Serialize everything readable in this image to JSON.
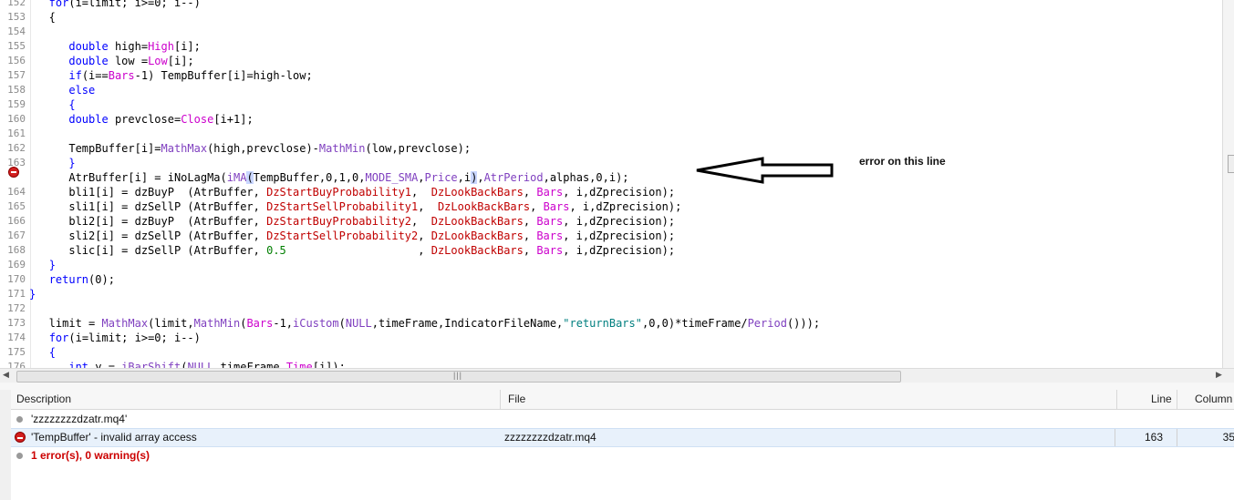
{
  "editor": {
    "line_numbers": [
      "152",
      "153",
      "154",
      "155",
      "156",
      "157",
      "158",
      "159",
      "160",
      "161",
      "162",
      "163",
      "164",
      "165",
      "166",
      "167",
      "168",
      "169",
      "170",
      "171",
      "172",
      "173",
      "174",
      "175",
      "176"
    ],
    "code_lines": [
      "   for(i=limit; i>=0; i--)",
      "   {",
      "",
      "      double high=High[i];",
      "      double low =Low[i];",
      "      if(i==Bars-1) TempBuffer[i]=high-low;",
      "      else",
      "      {",
      "      double prevclose=Close[i+1];",
      "",
      "      TempBuffer[i]=MathMax(high,prevclose)-MathMin(low,prevclose);",
      "      }",
      "      AtrBuffer[i] = iNoLagMa(iMA(TempBuffer,0,1,0,MODE_SMA,Price,i),AtrPeriod,alphas,0,i);",
      "      bli1[i] = dzBuyP  (AtrBuffer, DzStartBuyProbability1,  DzLookBackBars, Bars, i,dZprecision);",
      "      sli1[i] = dzSellP (AtrBuffer, DzStartSellProbability1,  DzLookBackBars, Bars, i,dZprecision);",
      "      bli2[i] = dzBuyP  (AtrBuffer, DzStartBuyProbability2,  DzLookBackBars, Bars, i,dZprecision);",
      "      sli2[i] = dzSellP (AtrBuffer, DzStartSellProbability2, DzLookBackBars, Bars, i,dZprecision);",
      "      slic[i] = dzSellP (AtrBuffer, 0.5                    , DzLookBackBars, Bars, i,dZprecision);",
      "   }",
      "   return(0);",
      "}",
      "",
      "   limit = MathMax(limit,MathMin(Bars-1,iCustom(NULL,timeFrame,IndicatorFileName,\"returnBars\",0,0)*timeFrame/Period()));",
      "   for(i=limit; i>=0; i--)",
      "   {",
      "      int y = iBarShift(NULL,timeFrame,Time[i]);"
    ],
    "error_line": "163"
  },
  "annotation": {
    "text": "error on this line"
  },
  "error_list": {
    "columns": {
      "description": "Description",
      "file": "File",
      "line": "Line",
      "column": "Column"
    },
    "rows": [
      {
        "description": "'zzzzzzzzdzatr.mq4'",
        "file": "",
        "line": "",
        "column": "",
        "kind": "info"
      },
      {
        "description": "'TempBuffer' - invalid array access",
        "file": "zzzzzzzzdzatr.mq4",
        "line": "163",
        "column": "35",
        "kind": "error"
      }
    ],
    "summary": "1 error(s), 0 warning(s)"
  }
}
